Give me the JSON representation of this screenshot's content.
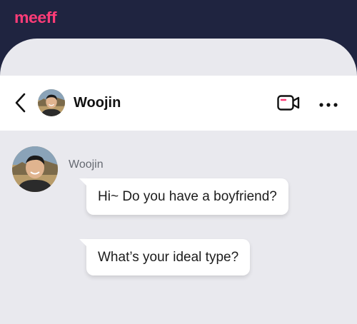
{
  "app": {
    "logo_text": "meeff",
    "brand_color": "#ff3c78",
    "topbar_color": "#1f2440"
  },
  "chat_header": {
    "contact_name": "Woojin",
    "back_icon": "chevron-left-icon",
    "video_icon": "video-call-icon",
    "more_icon": "more-horizontal-icon"
  },
  "messages": [
    {
      "sender": "Woojin",
      "text": "Hi~ Do you have a boyfriend?"
    },
    {
      "sender": "Woojin",
      "text": "What’s your ideal type?"
    }
  ]
}
